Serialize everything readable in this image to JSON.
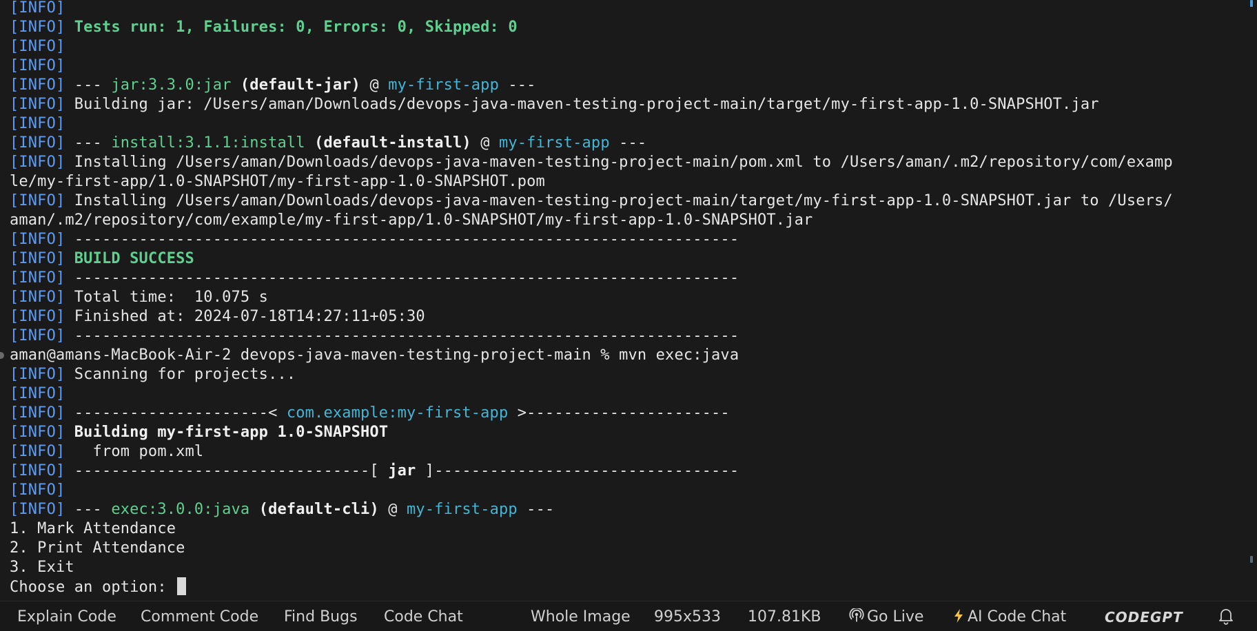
{
  "terminal": {
    "lines": [
      [
        {
          "s": "info",
          "t": "[INFO]"
        }
      ],
      [
        {
          "s": "info",
          "t": "[INFO]"
        },
        {
          "s": "text",
          "t": " "
        },
        {
          "s": "green-bold",
          "t": "Tests run: 1, Failures: 0, Errors: 0, Skipped: 0"
        }
      ],
      [
        {
          "s": "info",
          "t": "[INFO]"
        }
      ],
      [
        {
          "s": "info",
          "t": "[INFO]"
        }
      ],
      [
        {
          "s": "info",
          "t": "[INFO]"
        },
        {
          "s": "text",
          "t": " --- "
        },
        {
          "s": "green",
          "t": "jar:3.3.0:jar"
        },
        {
          "s": "text",
          "t": " "
        },
        {
          "s": "bold",
          "t": "(default-jar)"
        },
        {
          "s": "text",
          "t": " @ "
        },
        {
          "s": "cyan",
          "t": "my-first-app"
        },
        {
          "s": "text",
          "t": " ---"
        }
      ],
      [
        {
          "s": "info",
          "t": "[INFO]"
        },
        {
          "s": "text",
          "t": " Building jar: /Users/aman/Downloads/devops-java-maven-testing-project-main/target/my-first-app-1.0-SNAPSHOT.jar"
        }
      ],
      [
        {
          "s": "info",
          "t": "[INFO]"
        }
      ],
      [
        {
          "s": "info",
          "t": "[INFO]"
        },
        {
          "s": "text",
          "t": " --- "
        },
        {
          "s": "green",
          "t": "install:3.1.1:install"
        },
        {
          "s": "text",
          "t": " "
        },
        {
          "s": "bold",
          "t": "(default-install)"
        },
        {
          "s": "text",
          "t": " @ "
        },
        {
          "s": "cyan",
          "t": "my-first-app"
        },
        {
          "s": "text",
          "t": " ---"
        }
      ],
      [
        {
          "s": "info",
          "t": "[INFO]"
        },
        {
          "s": "text",
          "t": " Installing /Users/aman/Downloads/devops-java-maven-testing-project-main/pom.xml to /Users/aman/.m2/repository/com/examp"
        }
      ],
      [
        {
          "s": "text",
          "t": "le/my-first-app/1.0-SNAPSHOT/my-first-app-1.0-SNAPSHOT.pom"
        }
      ],
      [
        {
          "s": "info",
          "t": "[INFO]"
        },
        {
          "s": "text",
          "t": " Installing /Users/aman/Downloads/devops-java-maven-testing-project-main/target/my-first-app-1.0-SNAPSHOT.jar to /Users/"
        }
      ],
      [
        {
          "s": "text",
          "t": "aman/.m2/repository/com/example/my-first-app/1.0-SNAPSHOT/my-first-app-1.0-SNAPSHOT.jar"
        }
      ],
      [
        {
          "s": "info",
          "t": "[INFO]"
        },
        {
          "s": "text",
          "t": " ------------------------------------------------------------------------"
        }
      ],
      [
        {
          "s": "info",
          "t": "[INFO]"
        },
        {
          "s": "text",
          "t": " "
        },
        {
          "s": "green-bold",
          "t": "BUILD SUCCESS"
        }
      ],
      [
        {
          "s": "info",
          "t": "[INFO]"
        },
        {
          "s": "text",
          "t": " ------------------------------------------------------------------------"
        }
      ],
      [
        {
          "s": "info",
          "t": "[INFO]"
        },
        {
          "s": "text",
          "t": " Total time:  10.075 s"
        }
      ],
      [
        {
          "s": "info",
          "t": "[INFO]"
        },
        {
          "s": "text",
          "t": " Finished at: 2024-07-18T14:27:11+05:30"
        }
      ],
      [
        {
          "s": "info",
          "t": "[INFO]"
        },
        {
          "s": "text",
          "t": " ------------------------------------------------------------------------"
        }
      ],
      [
        {
          "s": "text",
          "t": "aman@amans-MacBook-Air-2 devops-java-maven-testing-project-main % mvn exec:java"
        }
      ],
      [
        {
          "s": "info",
          "t": "[INFO]"
        },
        {
          "s": "text",
          "t": " Scanning for projects..."
        }
      ],
      [
        {
          "s": "info",
          "t": "[INFO]"
        }
      ],
      [
        {
          "s": "info",
          "t": "[INFO]"
        },
        {
          "s": "text",
          "t": " ---------------------< "
        },
        {
          "s": "cyan",
          "t": "com.example:my-first-app"
        },
        {
          "s": "text",
          "t": " >----------------------"
        }
      ],
      [
        {
          "s": "info",
          "t": "[INFO]"
        },
        {
          "s": "text",
          "t": " "
        },
        {
          "s": "bold",
          "t": "Building my-first-app 1.0-SNAPSHOT"
        }
      ],
      [
        {
          "s": "info",
          "t": "[INFO]"
        },
        {
          "s": "text",
          "t": "   from pom.xml"
        }
      ],
      [
        {
          "s": "info",
          "t": "[INFO]"
        },
        {
          "s": "text",
          "t": " --------------------------------[ "
        },
        {
          "s": "bold",
          "t": "jar"
        },
        {
          "s": "text",
          "t": " ]---------------------------------"
        }
      ],
      [
        {
          "s": "info",
          "t": "[INFO]"
        }
      ],
      [
        {
          "s": "info",
          "t": "[INFO]"
        },
        {
          "s": "text",
          "t": " --- "
        },
        {
          "s": "green",
          "t": "exec:3.0.0:java"
        },
        {
          "s": "text",
          "t": " "
        },
        {
          "s": "bold",
          "t": "(default-cli)"
        },
        {
          "s": "text",
          "t": " @ "
        },
        {
          "s": "cyan",
          "t": "my-first-app"
        },
        {
          "s": "text",
          "t": " ---"
        }
      ],
      [
        {
          "s": "text",
          "t": "1. Mark Attendance"
        }
      ],
      [
        {
          "s": "text",
          "t": "2. Print Attendance"
        }
      ],
      [
        {
          "s": "text",
          "t": "3. Exit"
        }
      ],
      [
        {
          "s": "text",
          "t": "Choose an option: "
        }
      ]
    ],
    "cursor_line": 30,
    "prompt_marker_line": 18
  },
  "statusbar": {
    "explain_code": "Explain Code",
    "comment_code": "Comment Code",
    "find_bugs": "Find Bugs",
    "code_chat": "Code Chat",
    "whole_image": "Whole Image",
    "dimensions": "995x533",
    "file_size": "107.81KB",
    "go_live": "Go Live",
    "ai_code_chat": "AI Code Chat",
    "codegpt": "CODEGPT"
  },
  "icons": {
    "go_live": "broadcast-icon",
    "ai_code_chat": "lightning-icon",
    "notifications": "bell-icon"
  },
  "colors": {
    "background": "#1a1a1a",
    "info_tag": "#5c9cf5",
    "plugin_green": "#5fd08f",
    "artifact_cyan": "#43b6d6",
    "text": "#e6e6e6",
    "lightning": "#f5c542"
  }
}
